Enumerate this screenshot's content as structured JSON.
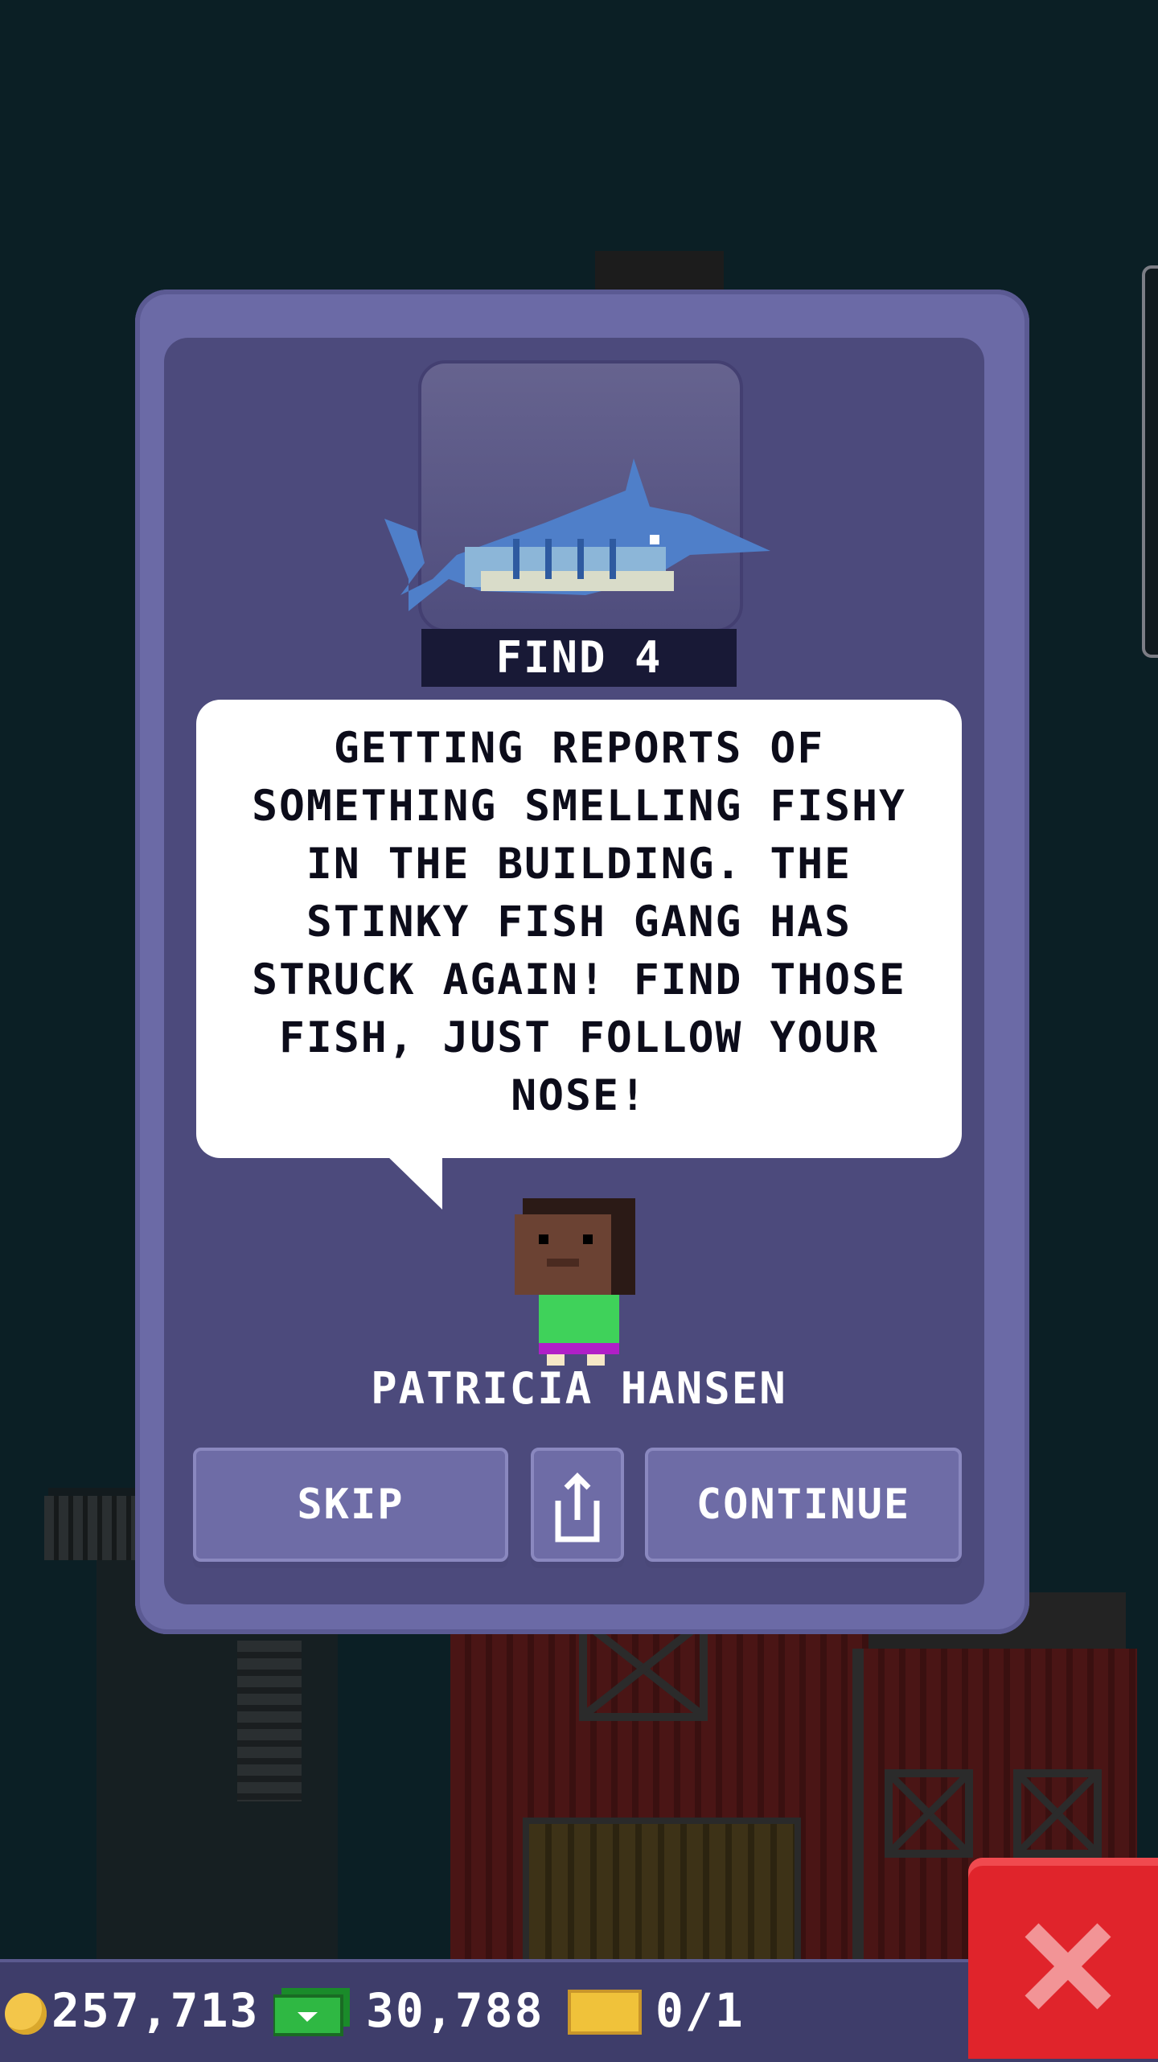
{
  "dialog": {
    "find_label": "FIND 4",
    "message": "GETTING REPORTS OF SOMETHING SMELLING FISHY IN THE BUILDING. THE STINKY FISH GANG HAS STRUCK AGAIN! FIND THOSE FISH, JUST FOLLOW YOUR NOSE!",
    "character_name": "PATRICIA HANSEN",
    "skip_label": "SKIP",
    "continue_label": "CONTINUE",
    "share_icon": "share-icon"
  },
  "status_bar": {
    "coins": "257,713",
    "bux": "30,788",
    "tickets": "0/1"
  },
  "colors": {
    "dialog_border": "#6b6aa6",
    "dialog_body": "#4c4a7c",
    "close_button": "#e0242b",
    "coin": "#f3c64a"
  }
}
